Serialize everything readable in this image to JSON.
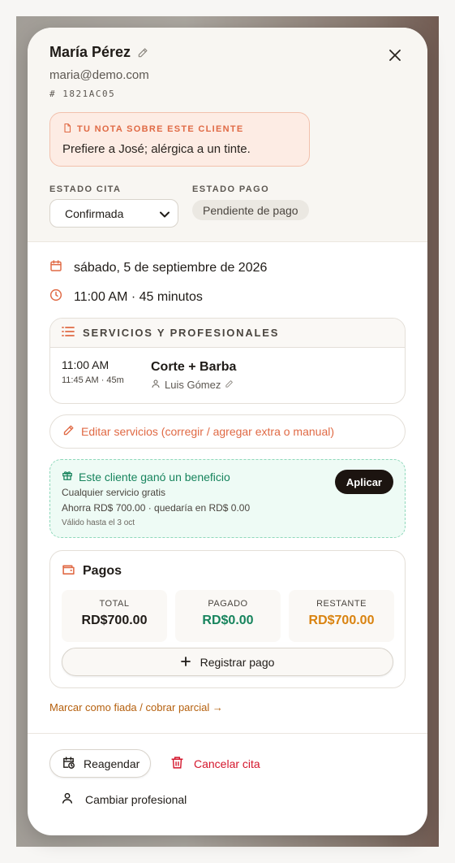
{
  "client": {
    "name": "María Pérez",
    "email": "maria@demo.com",
    "id": "# 1821AC05"
  },
  "note": {
    "title": "TU NOTA SOBRE ESTE CLIENTE",
    "text": "Prefiere a José; alérgica a un tinte."
  },
  "status": {
    "cita_label": "ESTADO CITA",
    "cita_value": "Confirmada",
    "cita_options": [
      "Confirmada"
    ],
    "pago_label": "ESTADO PAGO",
    "pago_value": "Pendiente de pago"
  },
  "appointment": {
    "date": "sábado, 5 de septiembre de 2026",
    "time": "11:00 AM · 45 minutos"
  },
  "services": {
    "header": "SERVICIOS Y PROFESIONALES",
    "items": [
      {
        "start": "11:00 AM",
        "end": "11:45 AM · 45m",
        "name": "Corte + Barba",
        "professional": "Luis Gómez"
      }
    ],
    "edit_label": "Editar servicios (corregir / agregar extra o manual)"
  },
  "benefit": {
    "title": "Este cliente ganó un beneficio",
    "description": "Cualquier servicio gratis",
    "savings": "Ahorra RD$ 700.00 · quedaría en RD$ 0.00",
    "valid": "Válido hasta el 3 oct",
    "apply_label": "Aplicar"
  },
  "payments": {
    "title": "Pagos",
    "total_label": "TOTAL",
    "total_value": "RD$700.00",
    "paid_label": "PAGADO",
    "paid_value": "RD$0.00",
    "remaining_label": "RESTANTE",
    "remaining_value": "RD$700.00",
    "register_label": "Registrar pago"
  },
  "links": {
    "fiada": "Marcar como fiada / cobrar parcial →"
  },
  "actions": {
    "reschedule": "Reagendar",
    "cancel": "Cancelar cita",
    "change_pro": "Cambiar profesional"
  },
  "colors": {
    "accent": "#e06a45",
    "success": "#17845d",
    "warning": "#d98310",
    "danger": "#d4162c",
    "dark": "#1c1410"
  }
}
